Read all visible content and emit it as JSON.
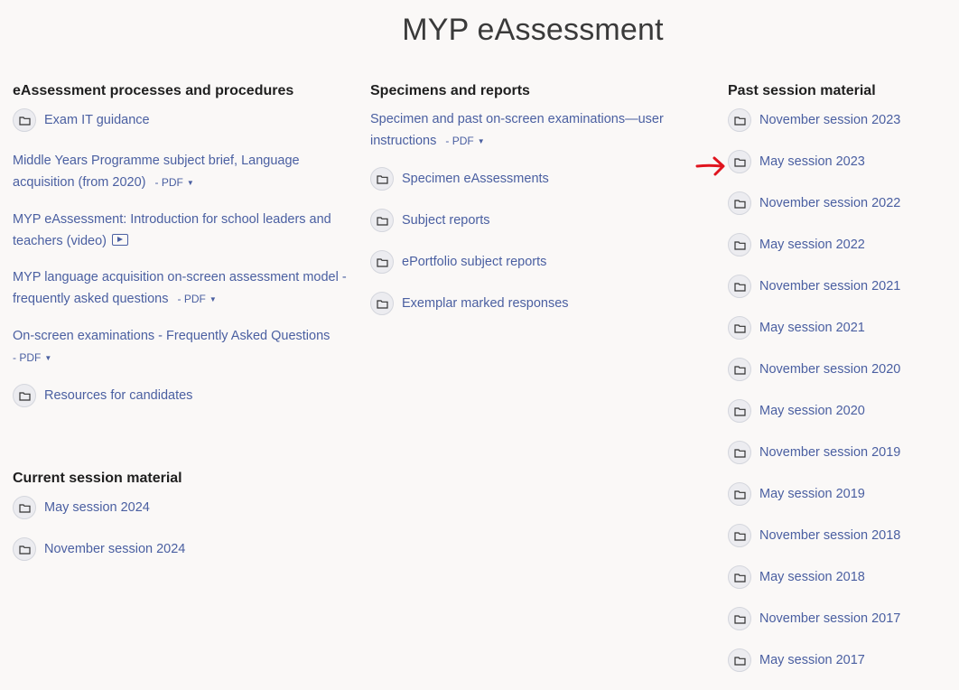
{
  "page": {
    "title": "MYP eAssessment"
  },
  "col1": {
    "heading": "eAssessment processes and procedures",
    "folder1": "Exam IT guidance",
    "brief_text": "Middle Years Programme subject brief, Language acquisition (from 2020)",
    "brief_pdf": "- PDF",
    "intro_text": "MYP eAssessment: Introduction for school leaders and teachers (video)",
    "faq_lang_text": "MYP language acquisition on-screen assessment model - frequently asked questions",
    "faq_lang_pdf": "- PDF",
    "faq_exam_text": "On-screen examinations - Frequently Asked Questions",
    "faq_exam_pdf": "- PDF",
    "folder2": "Resources for candidates"
  },
  "current": {
    "heading": "Current session material",
    "items": [
      "May session 2024",
      "November session 2024"
    ]
  },
  "col2": {
    "heading": "Specimens and reports",
    "instructions_text": "Specimen and past on-screen examinations—user instructions",
    "instructions_pdf": "- PDF",
    "folders": [
      "Specimen eAssessments",
      "Subject reports",
      "ePortfolio subject reports",
      "Exemplar marked responses"
    ]
  },
  "col3": {
    "heading": "Past session material",
    "items": [
      "November session 2023",
      "May session 2023",
      "November session 2022",
      "May session 2022",
      "November session 2021",
      "May session 2021",
      "November session 2020",
      "May session 2020",
      "November session 2019",
      "May session 2019",
      "November session 2018",
      "May session 2018",
      "November session 2017",
      "May session 2017"
    ]
  },
  "icons": {
    "folder": "folder-icon",
    "video": "video-icon",
    "annotation_arrow": "red-arrow-annotation"
  },
  "colors": {
    "link": "#4a5fa1",
    "background": "#faf8f7",
    "arrow": "#e0141e"
  }
}
